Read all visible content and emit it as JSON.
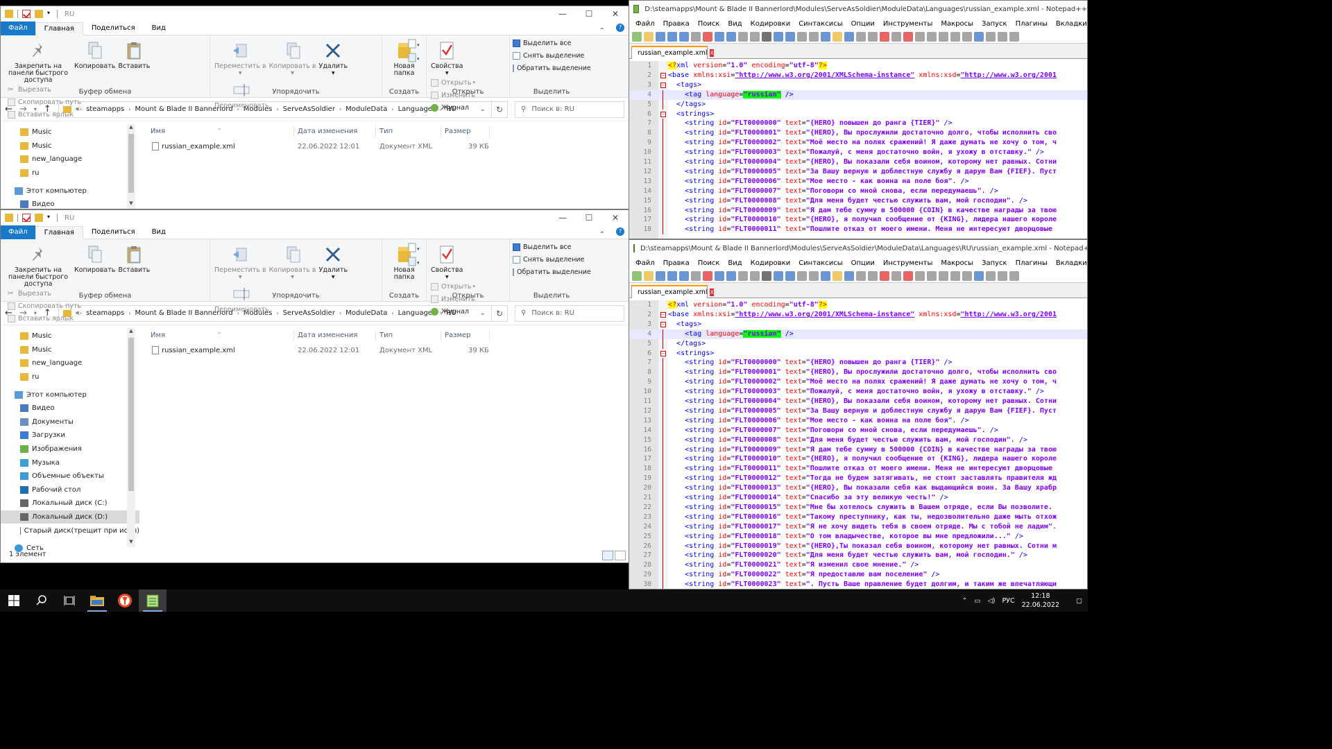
{
  "explorer": {
    "title": "RU",
    "tabs": [
      "Файл",
      "Главная",
      "Поделиться",
      "Вид"
    ],
    "ribbon": {
      "clipboard": {
        "pin": "Закрепить на панели быстрого доступа",
        "copy": "Копировать",
        "paste": "Вставить",
        "cut": "Вырезать",
        "copy_path": "Скопировать путь",
        "paste_shortcut": "Вставить ярлык",
        "label": "Буфер обмена"
      },
      "organize": {
        "move": "Переместить в",
        "copy_to": "Копировать в",
        "delete": "Удалить",
        "rename": "Переименовать",
        "label": "Упорядочить"
      },
      "create": {
        "new_folder": "Новая папка",
        "label": "Создать"
      },
      "open": {
        "properties": "Свойства",
        "open": "Открыть",
        "edit": "Изменить",
        "history": "Журнал",
        "label": "Открыть"
      },
      "select": {
        "select_all": "Выделить все",
        "select_none": "Снять выделение",
        "invert": "Обратить выделение",
        "label": "Выделить"
      }
    },
    "address": {
      "prefix": "«",
      "segments": [
        "steamapps",
        "Mount & Blade II Bannerlord",
        "Modules",
        "ServeAsSoldier",
        "ModuleData",
        "Languages",
        "RU"
      ],
      "search_placeholder": "Поиск в: RU"
    },
    "columns": [
      "Имя",
      "Дата изменения",
      "Тип",
      "Размер"
    ],
    "files": [
      {
        "name": "russian_example.xml",
        "date": "22.06.2022 12:01",
        "type": "Документ XML",
        "size": "39 КБ"
      }
    ],
    "nav_top": [
      "Music",
      "Music",
      "new_language",
      "ru"
    ],
    "nav_computer": [
      "Этот компьютер",
      "Видео",
      "Документы",
      "Загрузки",
      "Изображения",
      "Музыка",
      "Объемные объекты",
      "Рабочий стол",
      "Локальный диск (C:)",
      "Локальный диск (D:)",
      "Старый диск(трещит при испл)"
    ],
    "nav_network": "Сеть",
    "status": "1 элемент"
  },
  "notepad": {
    "title": "D:\\steamapps\\Mount & Blade II Bannerlord\\Modules\\ServeAsSoldier\\ModuleData\\Languages\\russian_example.xml - Notepad++",
    "title2": "D:\\steamapps\\Mount & Blade II Bannerlord\\Modules\\ServeAsSoldier\\ModuleData\\Languages\\RU\\russian_example.xml - Notepad++",
    "menu": [
      "Файл",
      "Правка",
      "Поиск",
      "Вид",
      "Кодировки",
      "Синтаксисы",
      "Опции",
      "Инструменты",
      "Макросы",
      "Запуск",
      "Плагины",
      "Вкладки",
      "?"
    ],
    "tab": "russian_example.xml",
    "tab_close": "X",
    "xml_decl": "xml version=\"1.0\" encoding=\"utf-8\"",
    "base_xsi": "http://www.w3.org/2001/XMLSchema-instance",
    "base_xsd": "http://www.w3.org/2001",
    "tag_language": "russian",
    "strings": [
      [
        "FLT0000000",
        "{HERO} повышен до ранга {TIER}\" />"
      ],
      [
        "FLT0000001",
        "{HERO}, Вы прослужили достаточно долго, чтобы исполнить сво"
      ],
      [
        "FLT0000002",
        "Моё место на полях сражений! Я даже думать не хочу о том, ч"
      ],
      [
        "FLT0000003",
        "Пожалуй, с меня достаточно войн, я ухожу в отставку.\" />"
      ],
      [
        "FLT0000004",
        "{HERO}, Вы показали себя воином, которому нет равных. Сотни"
      ],
      [
        "FLT0000005",
        "За Вашу верную и доблестную службу я дарую Вам {FIEF}. Пуст"
      ],
      [
        "FLT0000006",
        "Мое место - как воина на поле боя\". />"
      ],
      [
        "FLT0000007",
        "Поговори со мной снова, если передумаешь\". />"
      ],
      [
        "FLT0000008",
        "Для меня будет честью служить вам, мой господин\". />"
      ],
      [
        "FLT0000009",
        "Я дам тебе сумму в 500000 {COIN} в качестве награды за твою"
      ],
      [
        "FLT0000010",
        "{HERO}, я получил сообщение от {KING}, лидера нашего короле"
      ],
      [
        "FLT0000011",
        "Пошлите отказ от моего имени. Меня не интересуют дворцовые"
      ],
      [
        "FLT0000012",
        "Тогда не будем затягивать, не стоит заставлять правителя жд"
      ],
      [
        "FLT0000013",
        "{HERO}, Вы показали себя как выдающийся воин. За Вашу храбр"
      ],
      [
        "FLT0000014",
        "Спасибо за эту великую честь!\" />"
      ],
      [
        "FLT0000015",
        "Мне бы хотелось служить в Вашем отряде, если Вы позволите."
      ],
      [
        "FLT0000016",
        "Такому преступнику, как ты, недозволительно даже мыть отхож"
      ],
      [
        "FLT0000017",
        "Я не хочу видеть тебя в своем отряде. Мы с тобой не ладим\"."
      ],
      [
        "FLT0000018",
        "О том владычестве, которое вы мне предложили...\" />"
      ],
      [
        "FLT0000019",
        "{HERO},Ты показал себя воином, которому нет равных. Сотни м"
      ],
      [
        "FLT0000020",
        "Для меня будет честью служить вам, мой господин.\" />"
      ],
      [
        "FLT0000021",
        "Я изменил свое мнение.\" />"
      ],
      [
        "FLT0000022",
        "Я предоставлю вам поселение\" />"
      ],
      [
        "FLT0000023",
        ". Пусть Ваше правление будет долгим, и таким же впечатляющи"
      ]
    ]
  },
  "taskbar": {
    "lang": "РУС",
    "time": "12:18",
    "date": "22.06.2022"
  }
}
